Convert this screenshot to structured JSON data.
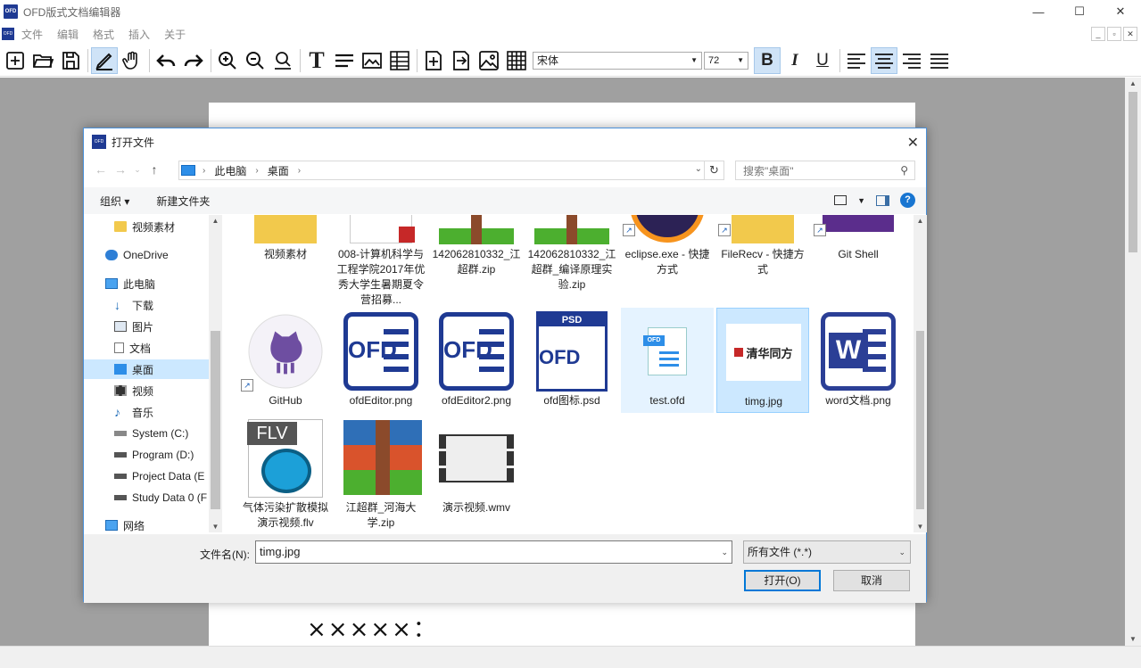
{
  "app": {
    "title": "OFD版式文档编辑器",
    "icon_text": "OFD",
    "window_buttons": {
      "minimize": "—",
      "maximize": "☐",
      "close": "✕"
    },
    "mdi_buttons": {
      "minimize": "_",
      "restore": "▫",
      "close": "✕"
    }
  },
  "menu": {
    "items": [
      "文件",
      "编辑",
      "格式",
      "插入",
      "关于"
    ]
  },
  "toolbar": {
    "font_name": "宋体",
    "font_size": "72",
    "text_tool_glyph": "T",
    "bold_glyph": "B",
    "italic_glyph": "I",
    "underline_glyph": "U",
    "icons": [
      "new-file-icon",
      "open-folder-icon",
      "save-icon",
      "pen-icon",
      "hand-icon",
      "undo-icon",
      "redo-icon",
      "zoom-in-icon",
      "zoom-out-icon",
      "zoom-fit-icon",
      "text-icon",
      "paragraph-icon",
      "image-frame-icon",
      "table-icon",
      "insert-page-icon",
      "import-icon",
      "insert-image-icon",
      "grid-icon"
    ]
  },
  "document": {
    "visible_text": "×××××："
  },
  "dialog": {
    "title": "打开文件",
    "close_glyph": "✕",
    "breadcrumb": [
      "此电脑",
      "桌面"
    ],
    "search_placeholder": "搜索\"桌面\"",
    "commands": {
      "organize": "组织 ▾",
      "new_folder": "新建文件夹"
    },
    "nav_items": [
      {
        "label": "视频素材",
        "icon": "folder-icon"
      },
      {
        "label": "OneDrive",
        "icon": "onedrive-icon"
      },
      {
        "label": "此电脑",
        "icon": "computer-icon"
      },
      {
        "label": "下载",
        "icon": "download-icon"
      },
      {
        "label": "图片",
        "icon": "pictures-icon"
      },
      {
        "label": "文档",
        "icon": "documents-icon"
      },
      {
        "label": "桌面",
        "icon": "desktop-icon",
        "selected": true
      },
      {
        "label": "视频",
        "icon": "videos-icon"
      },
      {
        "label": "音乐",
        "icon": "music-icon"
      },
      {
        "label": "System (C:)",
        "icon": "drive-icon"
      },
      {
        "label": "Program (D:)",
        "icon": "drive-icon"
      },
      {
        "label": "Project Data (E",
        "icon": "drive-icon"
      },
      {
        "label": "Study Data 0 (F",
        "icon": "drive-icon"
      },
      {
        "label": "网络",
        "icon": "network-icon"
      }
    ],
    "files": [
      {
        "name": "视频素材",
        "kind": "folder"
      },
      {
        "name": "008-计算机科学与工程学院2017年优秀大学生暑期夏令营招募...",
        "kind": "pdf"
      },
      {
        "name": "142062810332_江超群.zip",
        "kind": "zip"
      },
      {
        "name": "142062810332_江超群_编译原理实验.zip",
        "kind": "zip"
      },
      {
        "name": "eclipse.exe - 快捷方式",
        "kind": "eclipse",
        "shortcut": true
      },
      {
        "name": "FileRecv - 快捷方式",
        "kind": "folder",
        "shortcut": true
      },
      {
        "name": "Git Shell",
        "kind": "gitshell",
        "shortcut": true
      },
      {
        "name": "GitHub",
        "kind": "github",
        "shortcut": true
      },
      {
        "name": "ofdEditor.png",
        "kind": "ofd"
      },
      {
        "name": "ofdEditor2.png",
        "kind": "ofd"
      },
      {
        "name": "ofd图标.psd",
        "kind": "ofdpsd"
      },
      {
        "name": "test.ofd",
        "kind": "ofdfile",
        "state": "hover"
      },
      {
        "name": "timg.jpg",
        "kind": "timg",
        "state": "selected"
      },
      {
        "name": "word文档.png",
        "kind": "word"
      },
      {
        "name": "气体污染扩散模拟演示视频.flv",
        "kind": "flv"
      },
      {
        "name": "江超群_河海大学.zip",
        "kind": "winrar"
      },
      {
        "name": "演示视频.wmv",
        "kind": "wmv"
      }
    ],
    "thumb_texts": {
      "ofd": "OFD",
      "psd": "PSD",
      "flv": "FLV",
      "timg": "清华同方",
      "word": "W",
      "ofd_small": "OFD"
    },
    "footer": {
      "filename_label": "文件名(N):",
      "filename_value": "timg.jpg",
      "filetype_value": "所有文件 (*.*)",
      "open_button": "打开(O)",
      "cancel_button": "取消"
    }
  },
  "colors": {
    "ofd_blue": "#1f3a93",
    "selection": "#cce8ff",
    "accent": "#0078d7",
    "zip_green": "#4caf2f",
    "zip_brown": "#8b4a2b",
    "github_purple": "#6e4ea1",
    "word_blue": "#2b579a"
  }
}
